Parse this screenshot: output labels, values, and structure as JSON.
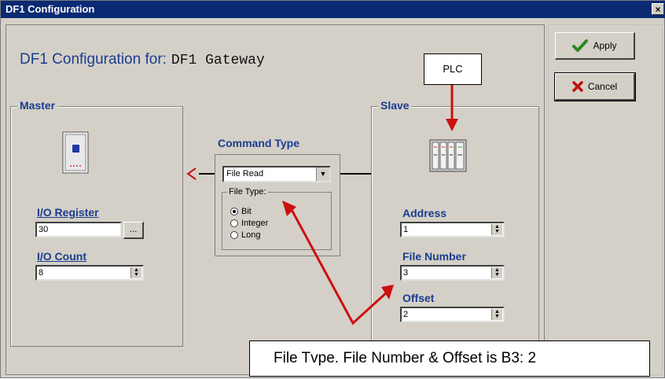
{
  "window": {
    "title": "DF1 Configuration",
    "close_label": "×"
  },
  "header": {
    "label": "DF1 Configuration for:",
    "device": "DF1 Gateway"
  },
  "buttons": {
    "apply": "Apply",
    "cancel": "Cancel"
  },
  "master": {
    "legend": "Master",
    "io_register_label": "I/O Register",
    "io_register_value": "30",
    "browse_label": "...",
    "io_count_label": "I/O Count",
    "io_count_value": "8"
  },
  "command": {
    "label": "Command Type",
    "selected": "File Read",
    "file_type_legend": "File Type:",
    "options": [
      "Bit",
      "Integer",
      "Long"
    ],
    "selected_option": "Bit"
  },
  "slave": {
    "legend": "Slave",
    "address_label": "Address",
    "address_value": "1",
    "file_number_label": "File Number",
    "file_number_value": "3",
    "offset_label": "Offset",
    "offset_value": "2"
  },
  "annotations": {
    "plc": "PLC",
    "note": "File Tvpe. File Number & Offset is B3: 2",
    "arrow_color": "#cc1010"
  },
  "icons": [
    "check-icon",
    "x-icon",
    "master-device-icon",
    "slave-rack-icon",
    "spin-icon",
    "dropdown-arrow-icon"
  ]
}
